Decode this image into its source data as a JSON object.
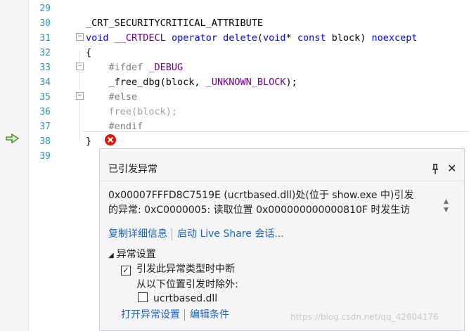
{
  "editor": {
    "lines": [
      {
        "num": "29",
        "segments": []
      },
      {
        "num": "30",
        "segments": [
          {
            "t": "_CRT_SECURITYCRITICAL_ATTRIBUTE",
            "c": ""
          }
        ]
      },
      {
        "num": "31",
        "segments": [
          {
            "t": "void",
            "c": "kw"
          },
          {
            "t": " ",
            "c": ""
          },
          {
            "t": "__CRTDECL",
            "c": "mac"
          },
          {
            "t": " ",
            "c": ""
          },
          {
            "t": "operator",
            "c": "kw"
          },
          {
            "t": " ",
            "c": ""
          },
          {
            "t": "delete",
            "c": "kw"
          },
          {
            "t": "(",
            "c": ""
          },
          {
            "t": "void",
            "c": "kw"
          },
          {
            "t": "* ",
            "c": ""
          },
          {
            "t": "const",
            "c": "kw"
          },
          {
            "t": " block) ",
            "c": ""
          },
          {
            "t": "noexcept",
            "c": "kw"
          }
        ]
      },
      {
        "num": "32",
        "segments": [
          {
            "t": "{",
            "c": ""
          }
        ]
      },
      {
        "num": "33",
        "segments": [
          {
            "t": "    #ifdef ",
            "c": "pp"
          },
          {
            "t": "_DEBUG",
            "c": "mac"
          }
        ]
      },
      {
        "num": "34",
        "segments": [
          {
            "t": "    _free_dbg(block, ",
            "c": ""
          },
          {
            "t": "_UNKNOWN_BLOCK",
            "c": "mac"
          },
          {
            "t": ");",
            "c": ""
          }
        ]
      },
      {
        "num": "35",
        "segments": [
          {
            "t": "    #else",
            "c": "pp"
          }
        ]
      },
      {
        "num": "36",
        "segments": [
          {
            "t": "    free(block);",
            "c": "inactive"
          }
        ]
      },
      {
        "num": "37",
        "segments": [
          {
            "t": "    #endif",
            "c": "pp"
          }
        ]
      },
      {
        "num": "38",
        "segments": [
          {
            "t": "}",
            "c": ""
          }
        ]
      },
      {
        "num": "39",
        "segments": []
      }
    ]
  },
  "icons": {
    "current_statement": "green-arrow-icon",
    "exception": "error-x-icon",
    "pin": "pin-icon",
    "close": "close-icon"
  },
  "popup": {
    "title": "已引发异常",
    "message_line1": "0x00007FFFD8C7519E (ucrtbased.dll)处(位于 show.exe 中)引发",
    "message_line2": "的异常: 0xC0000005: 读取位置 0x000000000000810F 时发生访",
    "link_copy_details": "复制详细信息",
    "link_live_share": "启动 Live Share 会话...",
    "section_title": "异常设置",
    "break_checkbox_label": "引发此异常类型时中断",
    "break_checkbox_checked": true,
    "except_when_thrown_from": "从以下位置引发时除外:",
    "dll_checkbox_label": "ucrtbased.dll",
    "dll_checkbox_checked": false,
    "link_open_settings": "打开异常设置",
    "link_edit_conditions": "编辑条件"
  },
  "watermark": "https://blog.csdn.net/qq_42604176",
  "colors": {
    "keyword": "#0000ff",
    "macro": "#6f008a",
    "preprocessor": "#808080",
    "link": "#1a64c8",
    "error": "#e51400"
  }
}
